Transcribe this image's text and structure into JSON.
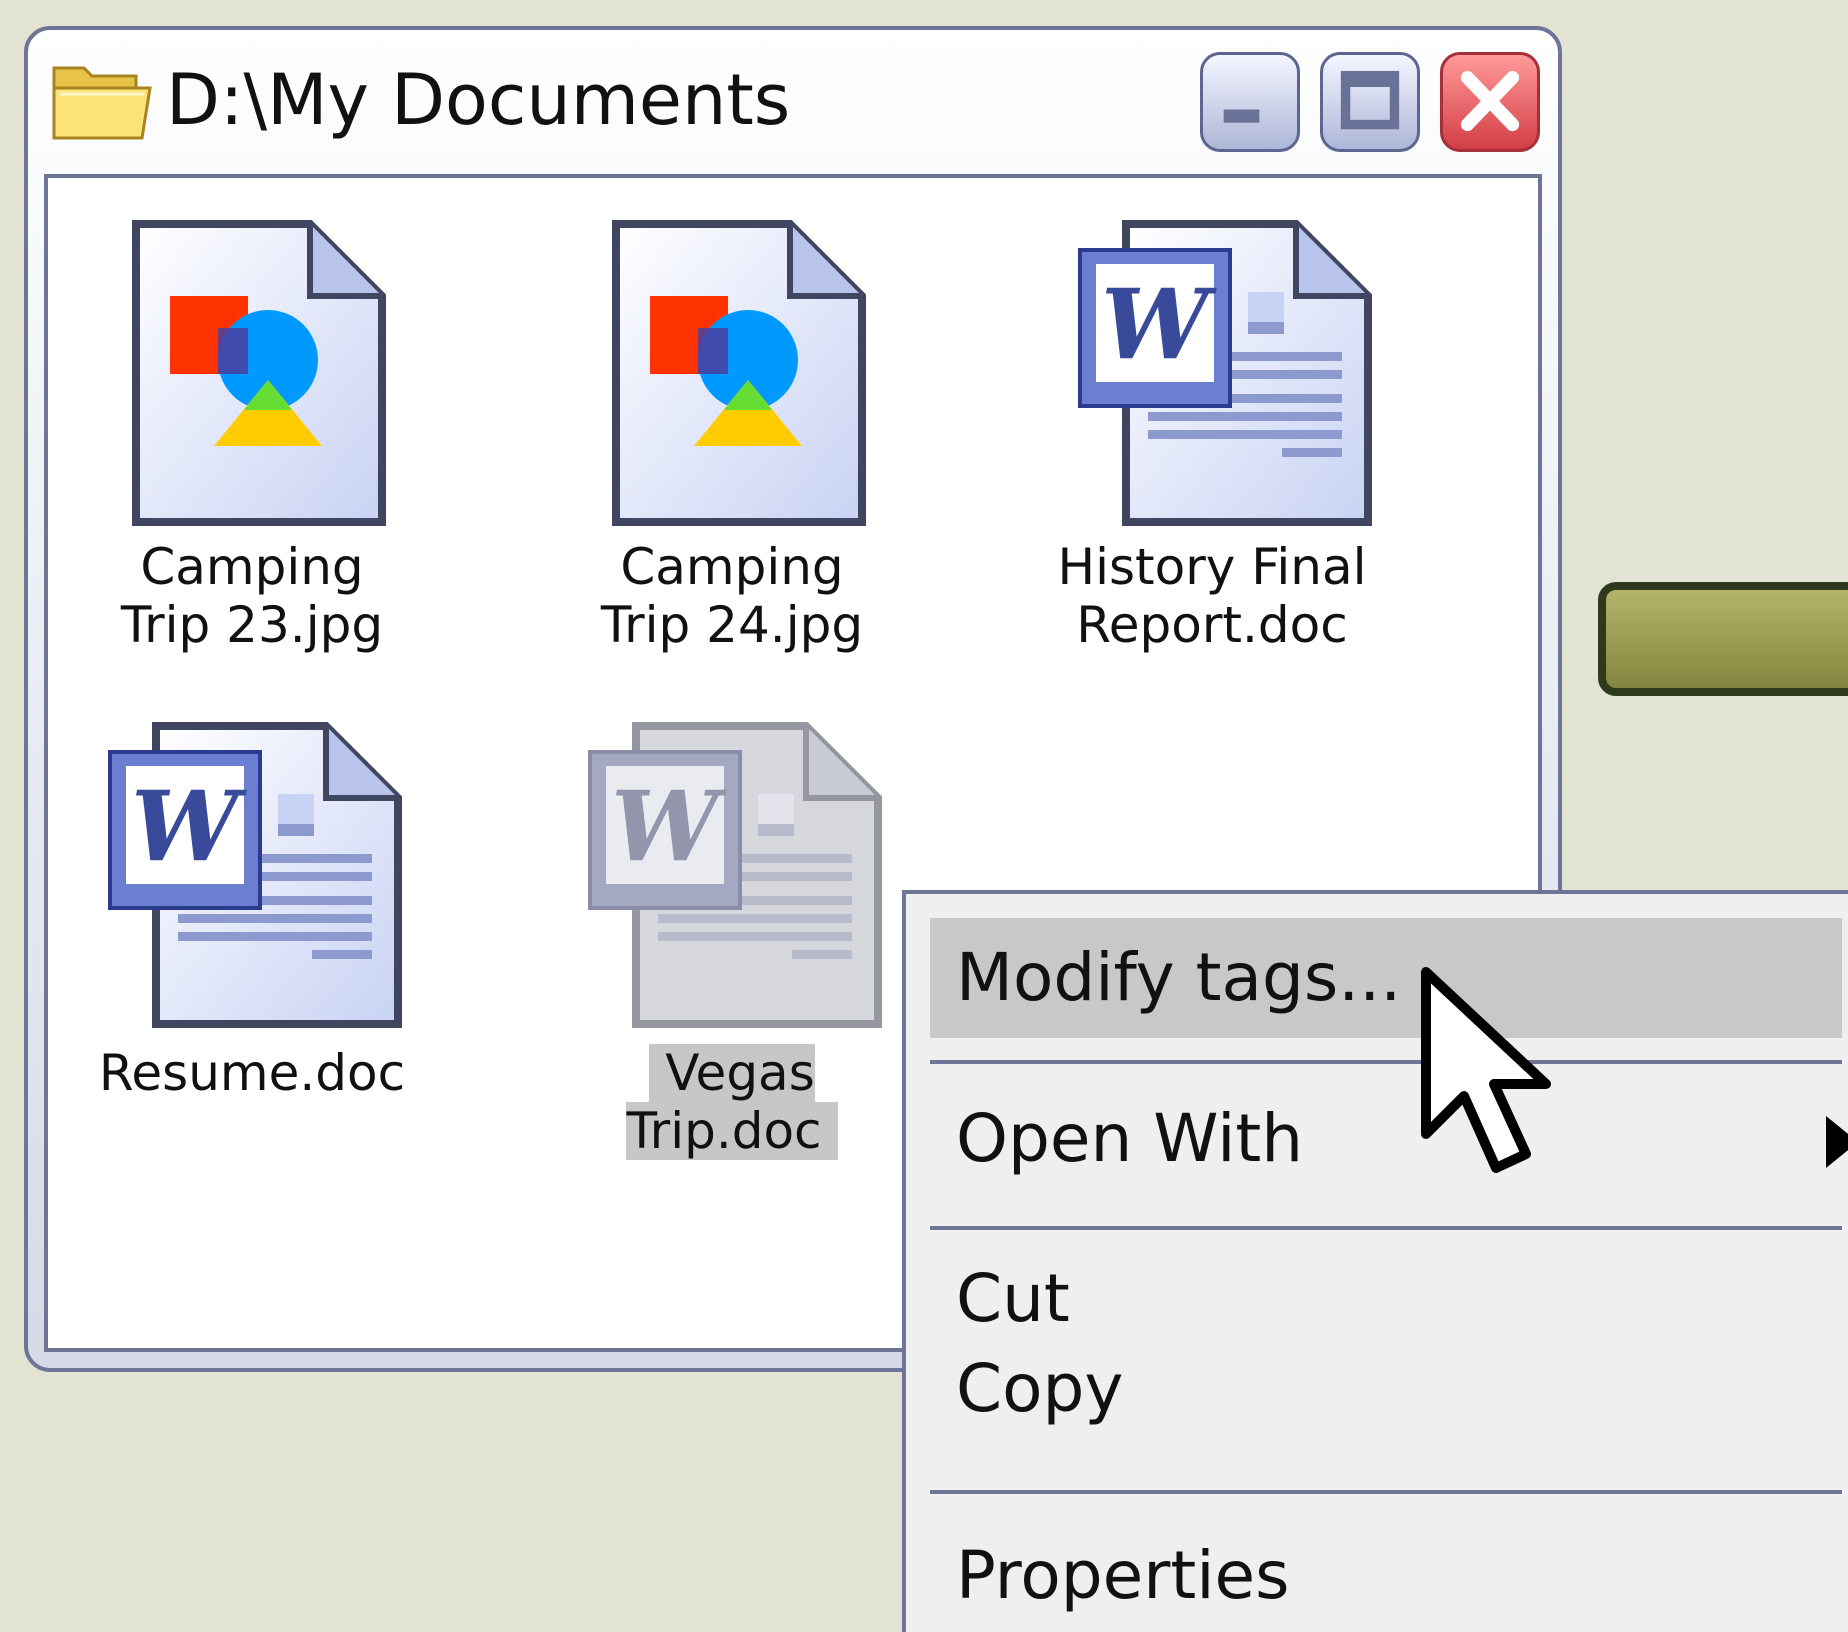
{
  "window": {
    "title": "D:\\My Documents",
    "icon": "folder-icon",
    "controls": [
      "minimize-icon",
      "maximize-icon",
      "close-icon"
    ]
  },
  "files": [
    {
      "name": "Camping\nTrip 23.jpg",
      "type": "image",
      "icon": "image-file-icon",
      "selected": false
    },
    {
      "name": "Camping\nTrip 24.jpg",
      "type": "image",
      "icon": "image-file-icon",
      "selected": false
    },
    {
      "name": "History Final\nReport.doc",
      "type": "word",
      "icon": "word-document-icon",
      "selected": false
    },
    {
      "name": "Resume.doc",
      "type": "word",
      "icon": "word-document-icon",
      "selected": false
    },
    {
      "name": "Vegas Trip.doc",
      "type": "word",
      "icon": "word-document-icon",
      "selected": true
    }
  ],
  "context_menu": {
    "items": [
      {
        "label": "Modify tags...",
        "highlighted": true
      },
      {
        "label": "Open With",
        "submenu": true
      },
      {
        "label": "Cut"
      },
      {
        "label": "Copy"
      },
      {
        "label": "Properties"
      }
    ]
  },
  "colors": {
    "background": "#e2e3d2",
    "window_border": "#6f7596",
    "selection": "#c7c7c7",
    "close_button": "#d33e45",
    "side_bar": "#9a9d52"
  }
}
